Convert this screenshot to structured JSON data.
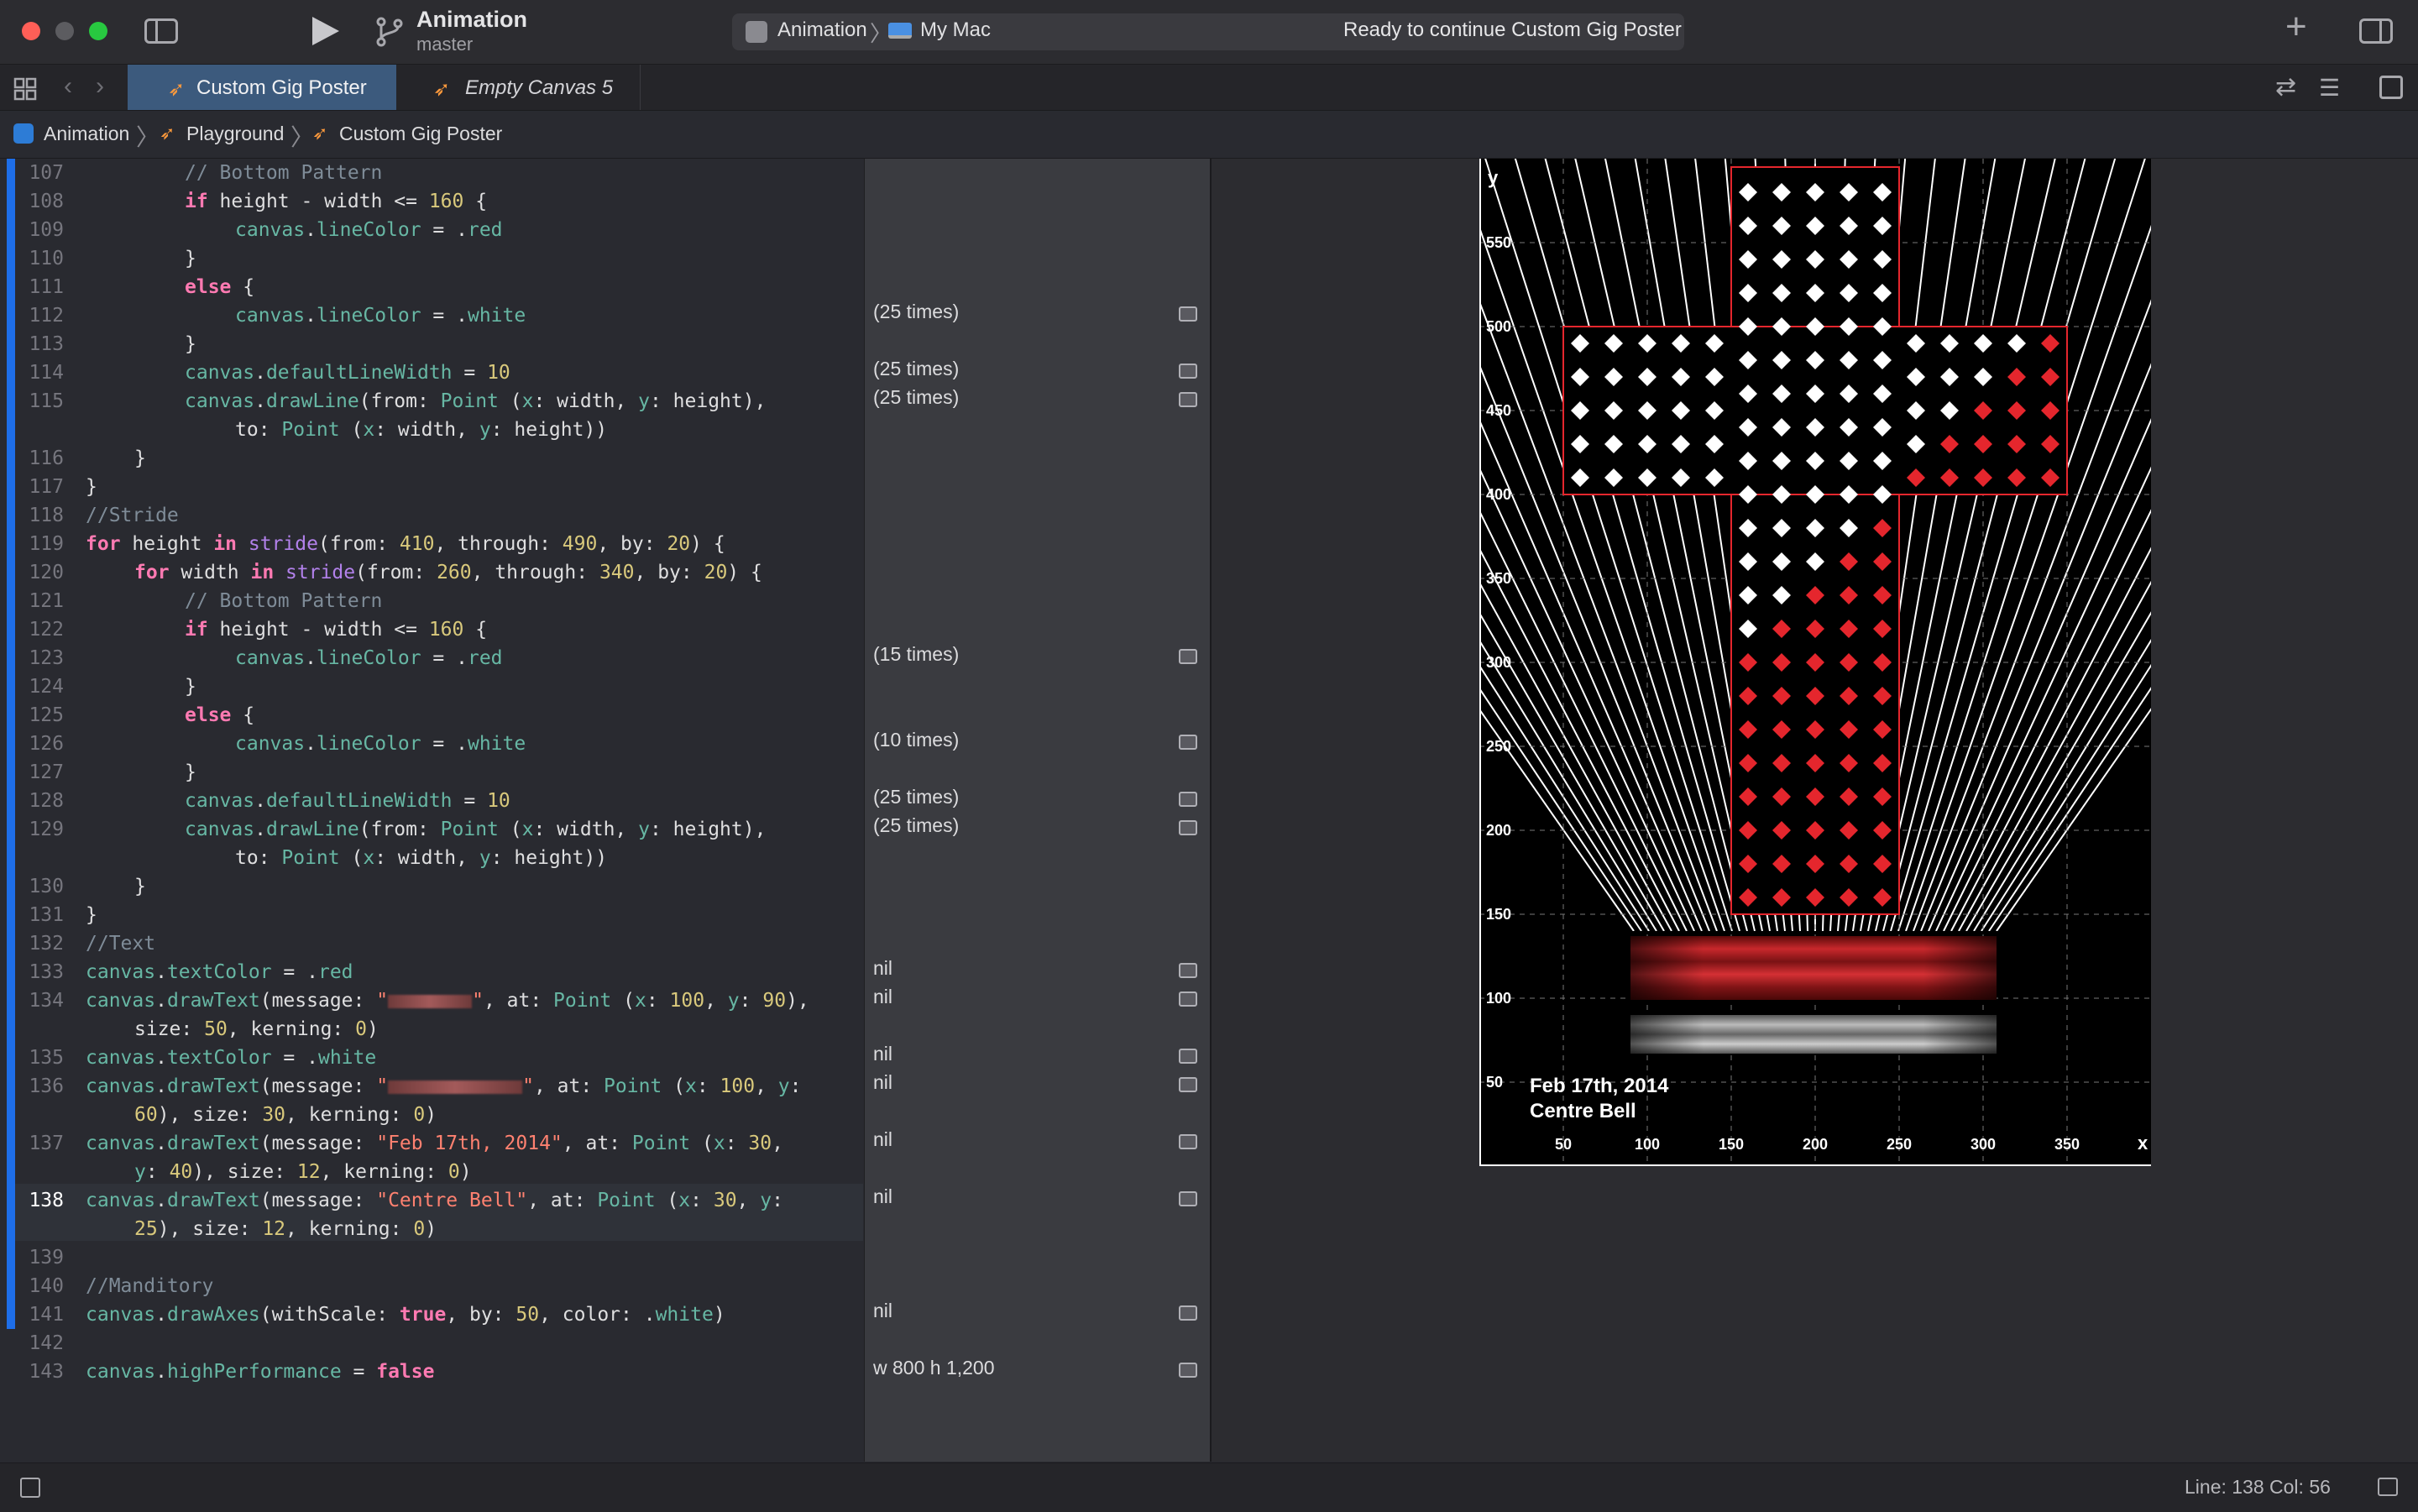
{
  "window": {
    "project_name": "Animation",
    "branch": "master",
    "scheme": "Animation",
    "destination": "My Mac",
    "status": "Ready to continue Custom Gig Poster"
  },
  "tabs": [
    {
      "label": "Custom Gig Poster",
      "active": true
    },
    {
      "label": "Empty Canvas 5",
      "active": false
    }
  ],
  "breadcrumb": [
    "Animation",
    "Playground",
    "Custom Gig Poster"
  ],
  "results": [
    {
      "line": 112,
      "text": "(25 times)"
    },
    {
      "line": 114,
      "text": "(25 times)"
    },
    {
      "line": 115,
      "text": "(25 times)"
    },
    {
      "line": 123,
      "text": "(15 times)"
    },
    {
      "line": 126,
      "text": "(10 times)"
    },
    {
      "line": 128,
      "text": "(25 times)"
    },
    {
      "line": 129,
      "text": "(25 times)"
    },
    {
      "line": 133,
      "text": "nil"
    },
    {
      "line": 134,
      "text": "nil"
    },
    {
      "line": 135,
      "text": "nil"
    },
    {
      "line": 136,
      "text": "nil"
    },
    {
      "line": 137,
      "text": "nil"
    },
    {
      "line": 138,
      "text": "nil"
    },
    {
      "line": 141,
      "text": "nil"
    },
    {
      "line": 143,
      "text": "w 800 h 1,200"
    }
  ],
  "canvas": {
    "title_line": "Feb 17th, 2014",
    "venue_line": "Centre Bell",
    "y_axis_label": "y",
    "x_axis_label": "x",
    "y_ticks": [
      "550",
      "500",
      "450",
      "400",
      "350",
      "300",
      "250",
      "200",
      "150",
      "100",
      "50"
    ],
    "x_ticks": [
      "50",
      "100",
      "150",
      "200",
      "250",
      "300",
      "350"
    ],
    "accent_red": "#e5262d"
  },
  "status_bar": {
    "cursor": "Line: 138  Col: 56"
  },
  "colors": {
    "keyword": "#ff7ab2",
    "number": "#d9c97c",
    "string": "#ff8170",
    "comment": "#7f8c98",
    "function": "#67b7a4",
    "tab_active": "#3c5a7d",
    "change_bar": "#1e6ee8"
  }
}
